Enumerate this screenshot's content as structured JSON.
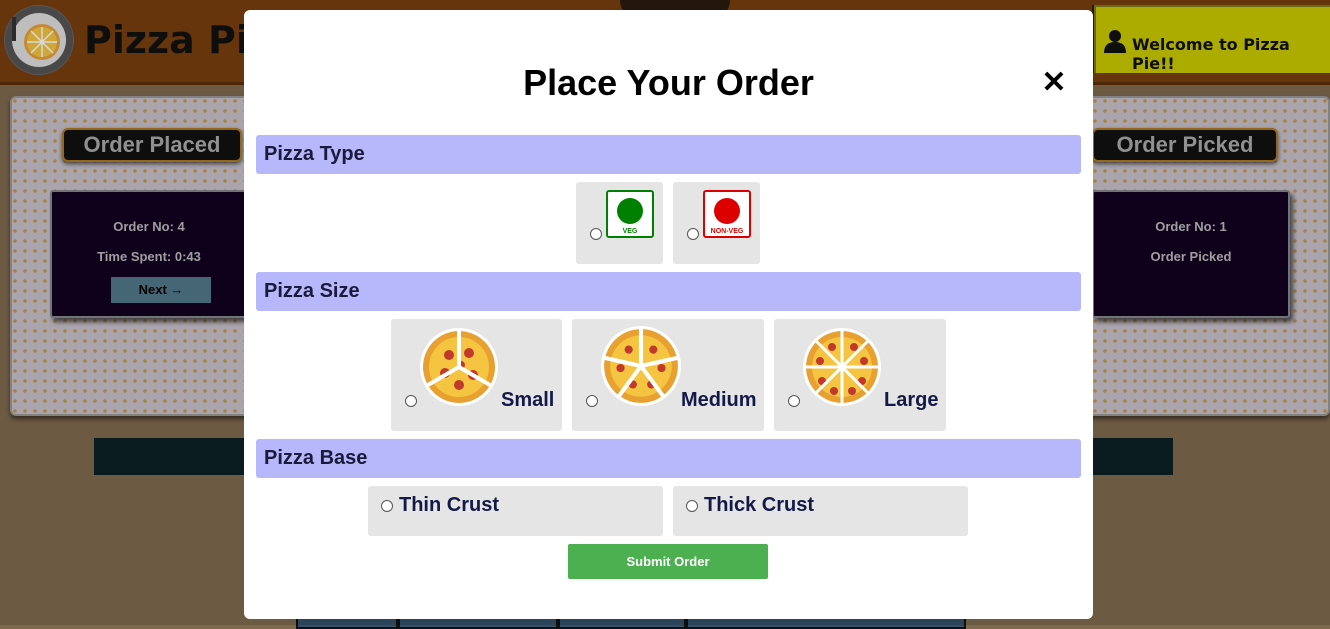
{
  "app": {
    "brand": "Pizza Pie",
    "welcome": "Welcome to Pizza Pie!!"
  },
  "stages": [
    {
      "title": "Order Placed",
      "order": "Order No: 4",
      "detail": "Time Spent: 0:43",
      "button": "Next →"
    },
    {
      "title": "Order Picked",
      "order": "Order No: 1",
      "detail": "Order Picked"
    }
  ],
  "modal": {
    "title": "Place Your Order",
    "close": "✕",
    "sections": {
      "type": {
        "title": "Pizza Type",
        "options": [
          {
            "label": "VEG",
            "color": "#008000"
          },
          {
            "label": "NON-VEG",
            "color": "#dd0000"
          }
        ]
      },
      "size": {
        "title": "Pizza Size",
        "options": [
          "Small",
          "Medium",
          "Large"
        ]
      },
      "base": {
        "title": "Pizza Base",
        "options": [
          "Thin Crust",
          "Thick Crust"
        ]
      }
    },
    "submit": "Submit Order"
  },
  "colors": {
    "section_header": "#b6b8fb",
    "submit": "#4caf50",
    "option_bg": "#e5e5e5"
  }
}
